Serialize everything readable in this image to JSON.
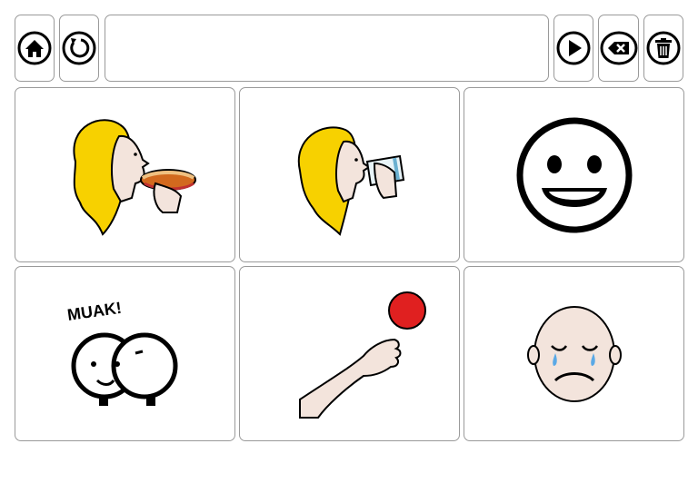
{
  "toolbar": {
    "left": [
      {
        "icon": "home-icon"
      },
      {
        "icon": "refresh-icon"
      }
    ],
    "message_bar": {
      "text": ""
    },
    "right": [
      {
        "icon": "play-icon"
      },
      {
        "icon": "backspace-icon"
      },
      {
        "icon": "trash-icon"
      }
    ]
  },
  "grid": {
    "tiles": [
      {
        "symbol": "eat-pictogram"
      },
      {
        "symbol": "drink-pictogram"
      },
      {
        "symbol": "happy-face-pictogram"
      },
      {
        "symbol": "kiss-pictogram",
        "caption": "MUAK!"
      },
      {
        "symbol": "throw-ball-pictogram"
      },
      {
        "symbol": "sad-crying-pictogram"
      }
    ]
  },
  "colors": {
    "border": "#9a9a9a",
    "hair": "#f7d100",
    "skin": "#f3e4dc",
    "ball": "#e02020",
    "sandwich": "#d2691e"
  }
}
